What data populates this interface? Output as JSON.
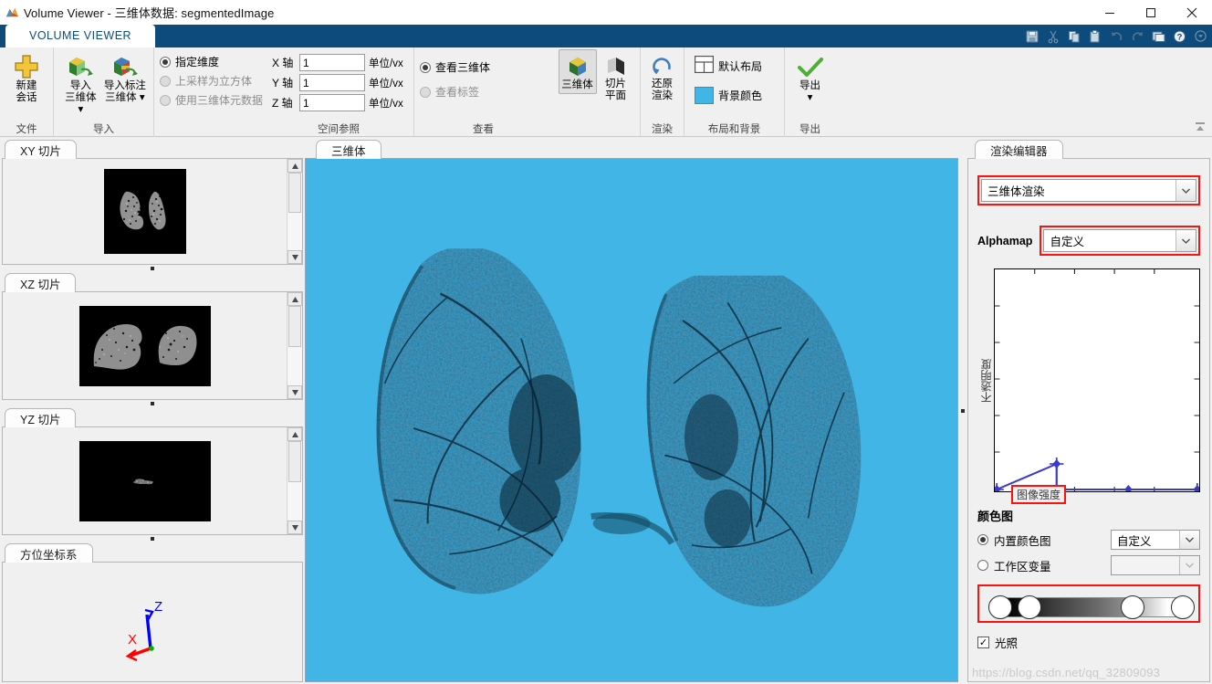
{
  "window": {
    "title": "Volume Viewer - 三维体数据: segmentedImage",
    "minimize": "—",
    "maximize": "□",
    "close": "✕"
  },
  "ribbon": {
    "tab": "VOLUME VIEWER",
    "quick_access": [
      {
        "name": "save-icon",
        "title": "保存"
      },
      {
        "name": "cut-icon",
        "title": "剪切"
      },
      {
        "name": "copy-icon",
        "title": "复制"
      },
      {
        "name": "paste-icon",
        "title": "粘贴"
      },
      {
        "name": "undo-icon",
        "title": "撤销"
      },
      {
        "name": "redo-icon",
        "title": "重做"
      },
      {
        "name": "window-icon",
        "title": "窗口"
      },
      {
        "name": "help-icon",
        "title": "帮助"
      },
      {
        "name": "chevron-down-icon",
        "title": "更多"
      }
    ],
    "groups": {
      "file": {
        "label": "文件",
        "new_session": "新建\n会话",
        "new_session_line1": "新建",
        "new_session_line2": "会话"
      },
      "import": {
        "label": "导入",
        "import_volume_line1": "导入",
        "import_volume_line2": "三维体",
        "import_labeled_line1": "导入标注",
        "import_labeled_line2": "三维体"
      },
      "spatial": {
        "label": "空间参照",
        "radios": [
          {
            "label": "指定维度",
            "selected": true,
            "disabled": false
          },
          {
            "label": "上采样为立方体",
            "selected": false,
            "disabled": true
          },
          {
            "label": "使用三维体元数据",
            "selected": false,
            "disabled": true
          }
        ],
        "axes": [
          {
            "label": "X 轴",
            "value": "1",
            "unit": "单位/vx"
          },
          {
            "label": "Y 轴",
            "value": "1",
            "unit": "单位/vx"
          },
          {
            "label": "Z 轴",
            "value": "1",
            "unit": "单位/vx"
          }
        ]
      },
      "view": {
        "label": "查看",
        "radios": [
          {
            "label": "查看三维体",
            "selected": true,
            "disabled": false
          },
          {
            "label": "查看标签",
            "selected": false,
            "disabled": true
          }
        ],
        "volume_line1": "三维体",
        "slice_line1": "切片",
        "slice_line2": "平面"
      },
      "render": {
        "label": "渲染",
        "restore_line1": "还原",
        "restore_line2": "渲染"
      },
      "layout": {
        "label": "布局和背景",
        "default_layout": "默认布局",
        "background_color": "背景颜色",
        "background_swatch": "#41b6e6"
      },
      "export": {
        "label": "导出",
        "export_label": "导出"
      }
    },
    "collapse_title": "最小化功能区"
  },
  "left_panels": [
    {
      "tab": "XY 切片",
      "name": "xy-slice"
    },
    {
      "tab": "XZ 切片",
      "name": "xz-slice"
    },
    {
      "tab": "YZ 切片",
      "name": "yz-slice"
    },
    {
      "tab": "方位坐标系",
      "name": "orientation-axes"
    }
  ],
  "orientation": {
    "x_label": "X",
    "z_label": "Z",
    "x_color": "#ff0000",
    "z_color": "#0000ff",
    "origin_color": "#00b000"
  },
  "viewport": {
    "tab": "三维体",
    "background_color": "#41b6e6",
    "object_color": "#103a52"
  },
  "render_editor": {
    "tab": "渲染编辑器",
    "render_mode": "三维体渲染",
    "alphamap_label": "Alphamap",
    "alphamap_value": "自定义",
    "plot": {
      "ylabel": "不透明度",
      "xlabel": "图像强度"
    },
    "colormap": {
      "title": "颜色图",
      "builtin_label": "内置颜色图",
      "builtin_value": "自定义",
      "builtin_selected": true,
      "workspace_label": "工作区变量",
      "workspace_value": "",
      "workspace_selected": false
    },
    "lighting": {
      "label": "光照",
      "checked": true,
      "check_glyph": "✓"
    }
  },
  "watermark": "https://blog.csdn.net/qq_32809093",
  "chart_data": {
    "type": "line",
    "title": "Alphamap",
    "xlabel": "图像强度",
    "ylabel": "不透明度",
    "xlim": [
      0,
      1
    ],
    "ylim": [
      0,
      1
    ],
    "grid": false,
    "points": [
      {
        "x": 0.0,
        "y": 0.0
      },
      {
        "x": 0.305,
        "y": 0.115
      },
      {
        "x": 0.305,
        "y": 0.0
      },
      {
        "x": 0.655,
        "y": 0.0
      },
      {
        "x": 1.0,
        "y": 0.0
      }
    ],
    "line_color": "#3a3ad0",
    "marker": "diamond"
  }
}
